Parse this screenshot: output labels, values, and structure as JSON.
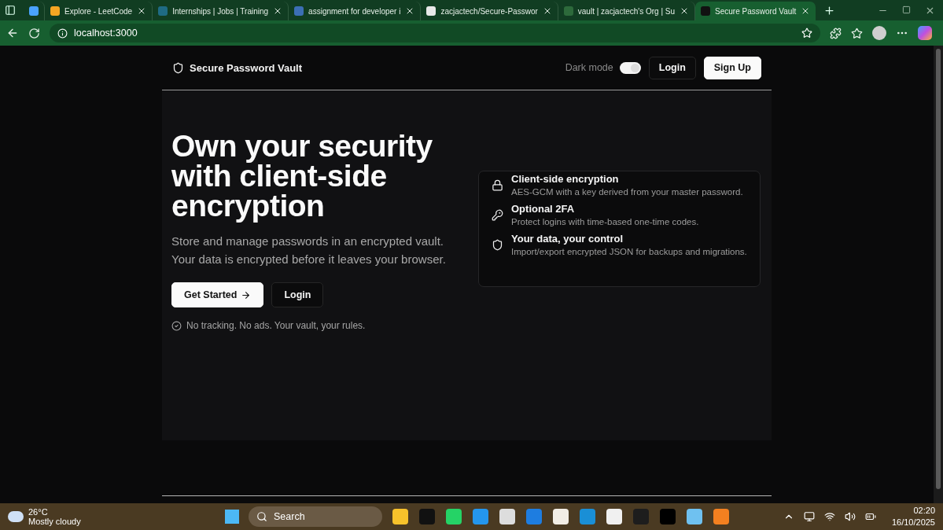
{
  "browser": {
    "tabs": [
      {
        "selected": false
      },
      {
        "title": "Explore - LeetCode",
        "selected": false
      },
      {
        "title": "Internships | Jobs | Training",
        "selected": false
      },
      {
        "title": "assignment for developer i",
        "selected": false
      },
      {
        "title": "zacjactech/Secure-Passwor",
        "selected": false
      },
      {
        "title": "vault | zacjactech's Org | Su",
        "selected": false
      },
      {
        "title": "Secure Password Vault",
        "selected": true
      }
    ],
    "address": "localhost:3000"
  },
  "header": {
    "brand": "Secure Password Vault",
    "dark_mode_label": "Dark mode",
    "dark_mode_on": true,
    "buttons": [
      {
        "label": "Login",
        "kind": "ghost"
      },
      {
        "label": "Sign Up",
        "kind": "solid"
      }
    ]
  },
  "hero": {
    "title": "Own your security with client-side encryption",
    "subtitle": "Store and manage passwords in an encrypted vault. Your data is encrypted before it leaves your browser.",
    "buttons": [
      {
        "label": "Get Started",
        "kind": "solid"
      },
      {
        "label": "Login",
        "kind": "ghost"
      }
    ],
    "note": "No tracking. No ads. Your vault, your rules."
  },
  "features": [
    {
      "kind": "lock",
      "title": "Client-side encryption",
      "text": "AES-GCM with a key derived from your master password."
    },
    {
      "kind": "key",
      "title": "Optional 2FA",
      "text": "Protect logins with time-based one-time codes."
    },
    {
      "kind": "shield",
      "title": "Your data, your control",
      "text": "Import/export encrypted JSON for backups and migrations."
    }
  ],
  "taskbar": {
    "temperature": "26°C",
    "weather": "Mostly cloudy",
    "search": "Search",
    "time": "02:20",
    "date": "16/10/2025"
  }
}
